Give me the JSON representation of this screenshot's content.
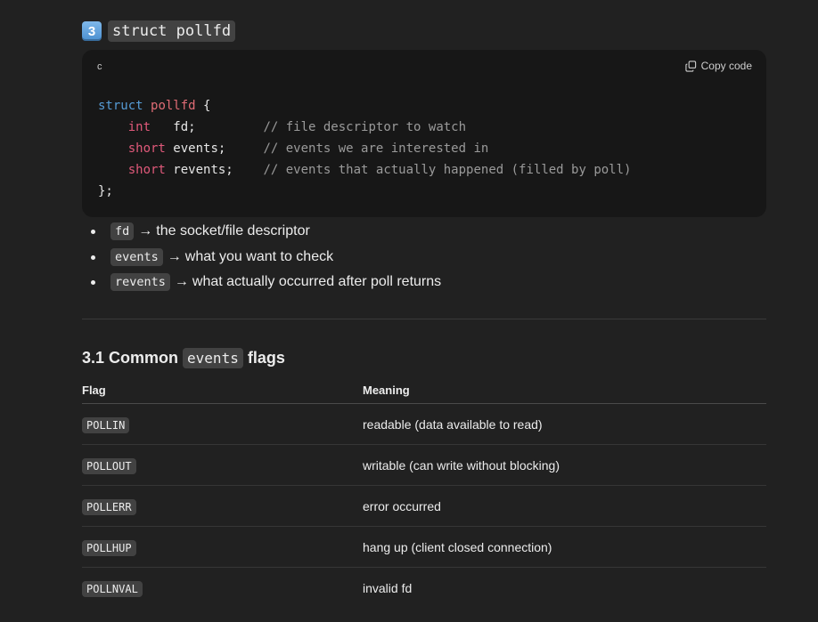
{
  "section": {
    "emoji": "3",
    "title_code": "struct pollfd"
  },
  "codeblock": {
    "language": "c",
    "copy_label": "Copy code",
    "icon": "copy-icon",
    "lines": {
      "l1_kw": "struct",
      "l1_name": "pollfd",
      "l1_rest": " {",
      "l2_type": "int",
      "l2_field": "   fd;         ",
      "l2_comment": "// file descriptor to watch",
      "l3_type": "short",
      "l3_field": " events;     ",
      "l3_comment": "// events we are interested in",
      "l4_type": "short",
      "l4_field": " revents;    ",
      "l4_comment": "// events that actually happened (filled by poll)",
      "l5": "};"
    }
  },
  "bullets": [
    {
      "code": "fd",
      "arrow": "→",
      "text": "the socket/file descriptor"
    },
    {
      "code": "events",
      "arrow": "→",
      "text": "what you want to check"
    },
    {
      "code": "revents",
      "arrow": "→",
      "text": "what actually occurred after poll returns"
    }
  ],
  "subsection": {
    "prefix": "3.1 Common",
    "code": "events",
    "suffix": "flags"
  },
  "table": {
    "headers": [
      "Flag",
      "Meaning"
    ],
    "rows": [
      {
        "flag": "POLLIN",
        "meaning": "readable (data available to read)"
      },
      {
        "flag": "POLLOUT",
        "meaning": "writable (can write without blocking)"
      },
      {
        "flag": "POLLERR",
        "meaning": "error occurred"
      },
      {
        "flag": "POLLHUP",
        "meaning": "hang up (client closed connection)"
      },
      {
        "flag": "POLLNVAL",
        "meaning": "invalid fd"
      }
    ]
  }
}
